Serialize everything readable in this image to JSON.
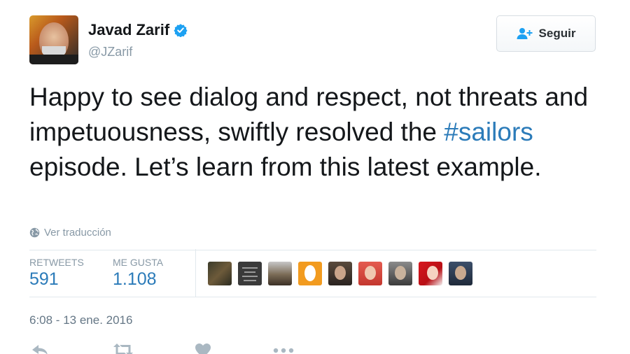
{
  "tweet": {
    "author": {
      "name": "Javad Zarif",
      "handle": "@JZarif",
      "verified": true
    },
    "follow_button": {
      "label": "Seguir",
      "icon": "add-person-icon"
    },
    "text_before": "Happy to see dialog and respect, not threats and impetuousness, swiftly resolved the ",
    "hashtag": "#sailors",
    "text_after": " episode. Let’s learn from this latest example.",
    "translate_label": "Ver traducción",
    "stats": {
      "retweets_label": "RETWEETS",
      "retweets_count": "591",
      "likes_label": "ME GUSTA",
      "likes_count": "1.108"
    },
    "likers_count_shown": 9,
    "timestamp": "6:08 - 13 ene. 2016",
    "actions": [
      "reply-icon",
      "retweet-icon",
      "heart-icon",
      "more-icon"
    ]
  },
  "colors": {
    "link": "#2b7bb9",
    "text": "#14171a",
    "muted": "#8899a6",
    "divider": "#e1e8ed",
    "verified": "#1da1f2"
  }
}
